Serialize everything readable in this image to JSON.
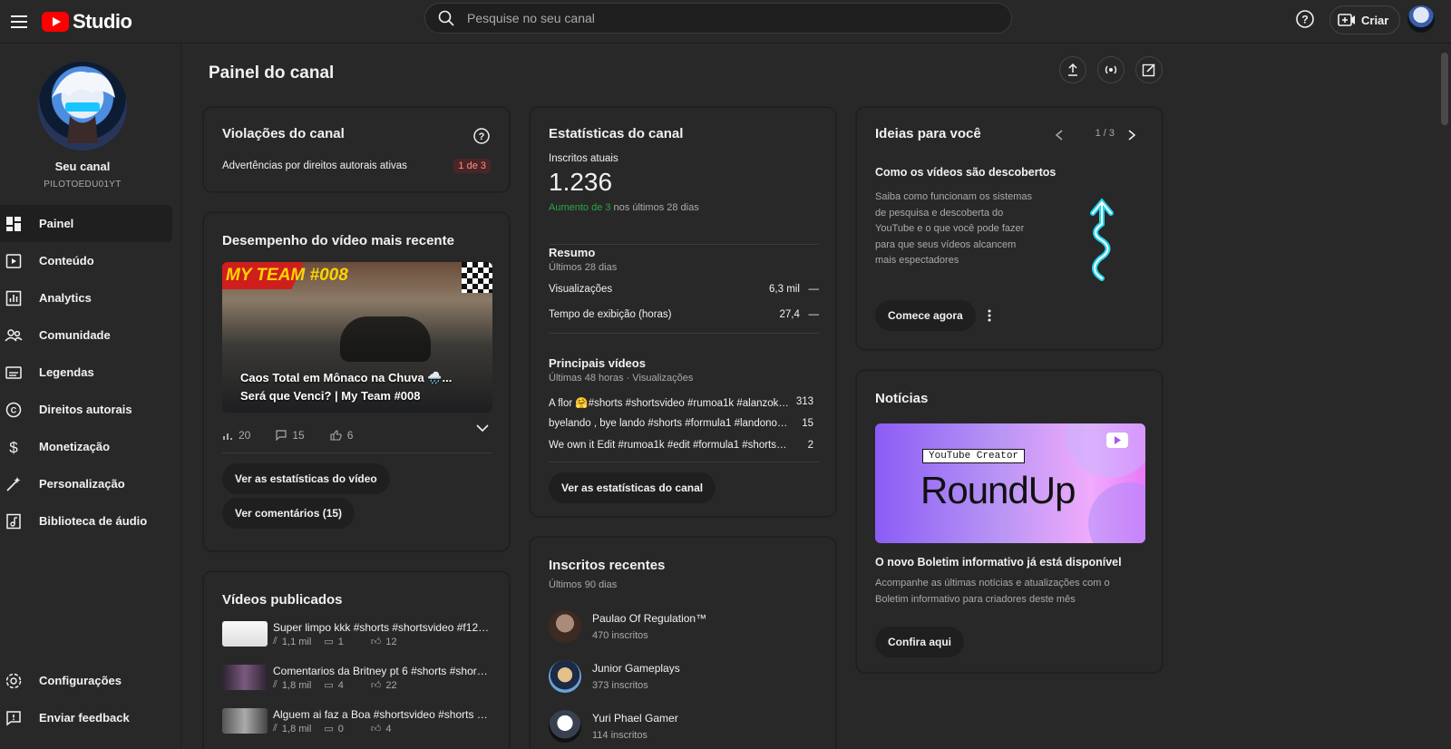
{
  "header": {
    "logo_text": "Studio",
    "search_placeholder": "Pesquise no seu canal",
    "create_label": "Criar"
  },
  "sidebar": {
    "channel_label": "Seu canal",
    "channel_handle": "PILOTOEDU01YT",
    "items": [
      {
        "label": "Painel",
        "icon": "dashboard-icon",
        "active": true
      },
      {
        "label": "Conteúdo",
        "icon": "content-icon"
      },
      {
        "label": "Analytics",
        "icon": "analytics-icon"
      },
      {
        "label": "Comunidade",
        "icon": "community-icon"
      },
      {
        "label": "Legendas",
        "icon": "subtitles-icon"
      },
      {
        "label": "Direitos autorais",
        "icon": "copyright-icon"
      },
      {
        "label": "Monetização",
        "icon": "dollar-icon"
      },
      {
        "label": "Personalização",
        "icon": "magic-wand-icon"
      },
      {
        "label": "Biblioteca de áudio",
        "icon": "audio-library-icon"
      }
    ],
    "bottom_items": [
      {
        "label": "Configurações",
        "icon": "gear-icon"
      },
      {
        "label": "Enviar feedback",
        "icon": "feedback-icon"
      }
    ]
  },
  "main": {
    "page_title": "Painel do canal"
  },
  "violations": {
    "title": "Violações do canal",
    "strikes_label": "Advertências por direitos autorais ativas",
    "strikes_value": "1 de 3"
  },
  "latest_video": {
    "title": "Desempenho do vídeo mais recente",
    "thumb_text": "MY TEAM #008",
    "caption": "Caos Total em Mônaco na Chuva 🌧️... Será que Venci? | My Team #008",
    "views": "20",
    "comments": "15",
    "likes": "6",
    "btn_stats": "Ver as estatísticas do vídeo",
    "btn_comments": "Ver comentários (15)"
  },
  "published": {
    "title": "Vídeos publicados",
    "items": [
      {
        "title": "Super limpo kkk #shorts #shortsvideo #f124 #...",
        "views": "1,1 mil",
        "comments": "1",
        "likes": "12"
      },
      {
        "title": "Comentarios da Britney pt 6 #shorts #shortsvi...",
        "views": "1,8 mil",
        "comments": "4",
        "likes": "22"
      },
      {
        "title": "Alguem ai faz a Boa #shortsvideo #shorts #m...",
        "views": "1,8 mil",
        "comments": "0",
        "likes": "4"
      }
    ]
  },
  "stats": {
    "title": "Estatísticas do canal",
    "subs_label": "Inscritos atuais",
    "subs_value": "1.236",
    "growth_green": "Aumento de 3",
    "growth_rest": " nos últimos 28 dias",
    "summary_title": "Resumo",
    "summary_period": "Últimos 28 dias",
    "rows": [
      {
        "label": "Visualizações",
        "value": "6,3 mil",
        "trend": "—"
      },
      {
        "label": "Tempo de exibição (horas)",
        "value": "27,4",
        "trend": "—"
      }
    ],
    "top_title": "Principais vídeos",
    "top_period": "Últimas 48 horas · Visualizações",
    "top_videos": [
      {
        "title": "A flor 🤗#shorts #shortsvideo #rumoa1k #alanzoka ...",
        "views": "313"
      },
      {
        "title": "byelando , bye lando #shorts #formula1 #landonorris...",
        "views": "15"
      },
      {
        "title": "We own it Edit #rumoa1k #edit #formula1 #shortsvi...",
        "views": "2"
      }
    ],
    "btn": "Ver as estatísticas do canal"
  },
  "recent_subs": {
    "title": "Inscritos recentes",
    "period": "Últimos 90 dias",
    "items": [
      {
        "name": "Paulao Of Regulation™",
        "count": "470 inscritos"
      },
      {
        "name": "Junior Gameplays",
        "count": "373 inscritos"
      },
      {
        "name": "Yuri Phael Gamer",
        "count": "114 inscritos"
      }
    ]
  },
  "ideas": {
    "title": "Ideias para você",
    "pager": "1 / 3",
    "subtitle": "Como os vídeos são descobertos",
    "body": "Saiba como funcionam os sistemas de pesquisa e descoberta do YouTube e o que você pode fazer para que seus vídeos alcancem mais espectadores",
    "btn": "Comece agora"
  },
  "news": {
    "title": "Notícias",
    "banner_small": "YouTube Creator",
    "banner_big": "RoundUp",
    "headline": "O novo Boletim informativo já está disponível",
    "body": "Acompanhe as últimas notícias e atualizações com o Boletim informativo para criadores deste mês",
    "btn": "Confira aqui"
  },
  "colors": {
    "accent_red": "#ff0000",
    "growth_green": "#2ba640",
    "cyan_art": "#22d3ee"
  }
}
